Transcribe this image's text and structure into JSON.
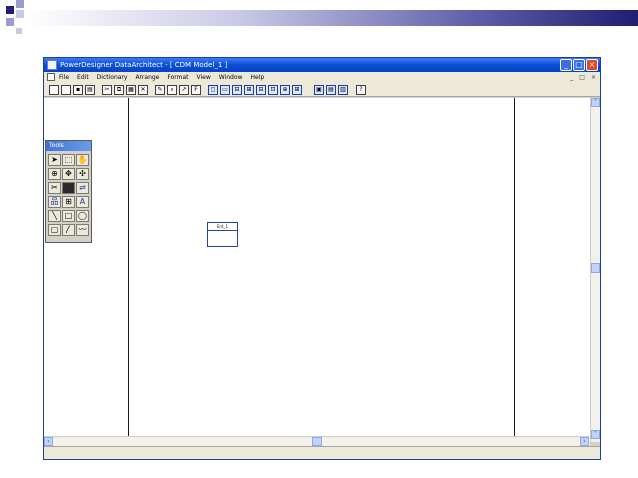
{
  "window": {
    "title": "PowerDesigner DataArchitect - [ CDM Model_1 ]",
    "buttons": {
      "minimize": "_",
      "maximize": "□",
      "close": "×"
    }
  },
  "menu": {
    "items": [
      "File",
      "Edit",
      "Dictionary",
      "Arrange",
      "Format",
      "View",
      "Window",
      "Help"
    ],
    "mdi_controls": [
      "_",
      "□",
      "×"
    ]
  },
  "toolbar": {
    "icons": [
      "new-icon",
      "open-icon",
      "save-icon",
      "print-icon",
      "cut-icon",
      "copy-icon",
      "paste-icon",
      "delete-icon",
      "pen-icon",
      "find-icon",
      "link-icon",
      "format-icon",
      "tool-a-icon",
      "tool-b-icon",
      "tool-c-icon",
      "tool-d-icon",
      "tool-e-icon",
      "tool-f-icon",
      "tool-g-icon",
      "tool-h-icon",
      "view-a-icon",
      "view-b-icon",
      "view-c-icon",
      "help-icon"
    ]
  },
  "palette": {
    "title": "Tools",
    "tools": [
      {
        "name": "pointer-tool",
        "glyph": "➤"
      },
      {
        "name": "lasso-tool",
        "glyph": "⬚"
      },
      {
        "name": "grabber-tool",
        "glyph": "✋"
      },
      {
        "name": "zoom-in-tool",
        "glyph": "⊕"
      },
      {
        "name": "zoom-out-tool",
        "glyph": "✥"
      },
      {
        "name": "move-tool",
        "glyph": "✣"
      },
      {
        "name": "scissors-tool",
        "glyph": "✂"
      },
      {
        "name": "entity-tool",
        "glyph": "▬"
      },
      {
        "name": "relationship-tool",
        "glyph": "⇌"
      },
      {
        "name": "inheritance-tool",
        "glyph": "品"
      },
      {
        "name": "association-tool",
        "glyph": "⊞"
      },
      {
        "name": "text-tool",
        "glyph": "A"
      },
      {
        "name": "line-tool",
        "glyph": "╲"
      },
      {
        "name": "rectangle-tool",
        "glyph": "□"
      },
      {
        "name": "ellipse-tool",
        "glyph": "◯"
      },
      {
        "name": "rounded-rect-tool",
        "glyph": "▢"
      },
      {
        "name": "polyline-tool",
        "glyph": "〳"
      },
      {
        "name": "freehand-tool",
        "glyph": "〰"
      }
    ]
  },
  "diagram": {
    "entity": {
      "name": "Ent_1"
    }
  },
  "colors": {
    "titlebar": "#0a4fd6",
    "entity_border": "#2d3fa8",
    "deco_square": "#1f1f73"
  }
}
